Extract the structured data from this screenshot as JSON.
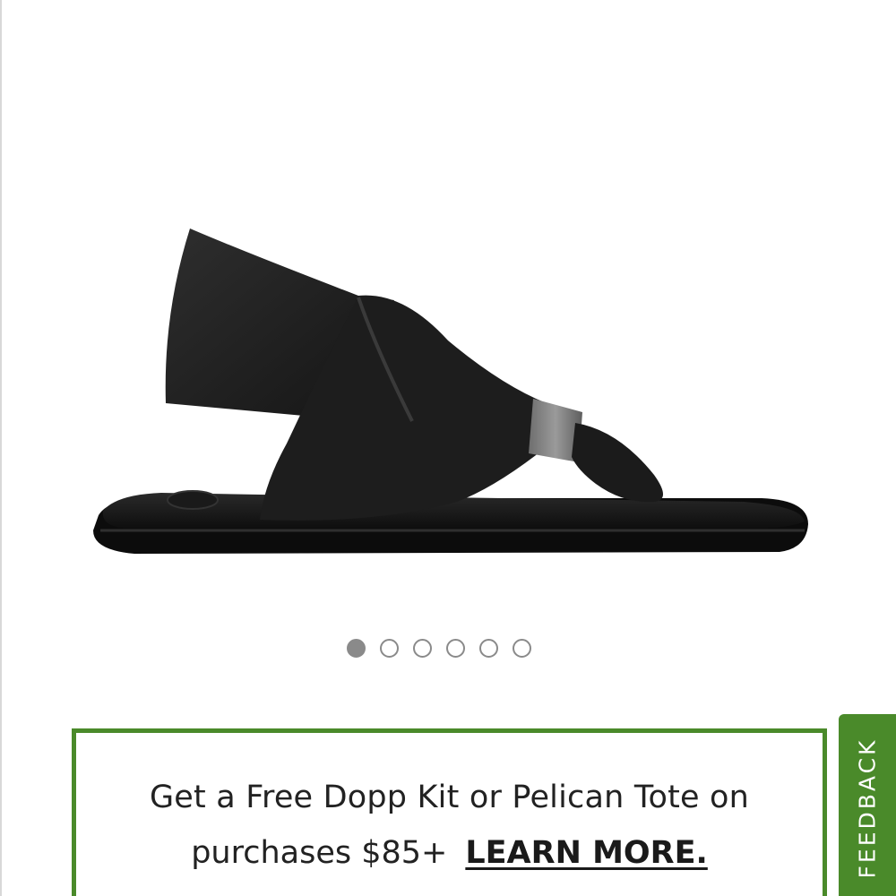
{
  "product": {
    "image_icon": "black-yoga-sling-sandal",
    "image_alt": "Black yoga sling sandal"
  },
  "carousel": {
    "dots": [
      {
        "active": true
      },
      {
        "active": false
      },
      {
        "active": false
      },
      {
        "active": false
      },
      {
        "active": false
      },
      {
        "active": false
      }
    ]
  },
  "promo": {
    "line1": "Get a Free Dopp Kit or Pelican Tote on",
    "line2_text": "purchases $85+",
    "link_label": "LEARN MORE."
  },
  "feedback": {
    "label": "FEEDBACK"
  },
  "colors": {
    "accent_green": "#4a8a2a",
    "dot_gray": "#8a8a8a",
    "text": "#222222"
  }
}
